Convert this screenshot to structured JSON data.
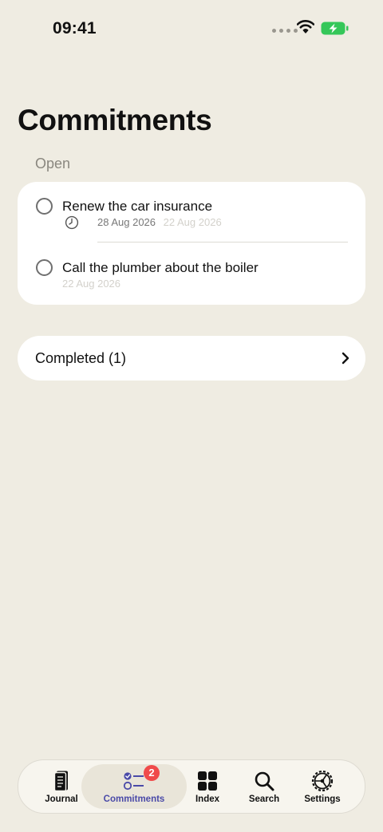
{
  "status_bar": {
    "time": "09:41",
    "battery_color": "#35c759"
  },
  "header": {
    "title": "Commitments"
  },
  "open_section": {
    "label": "Open",
    "tasks": [
      {
        "title": "Renew the car insurance",
        "due_date": "28 Aug 2026",
        "created_date": "22 Aug 2026",
        "icon": "clock-icon"
      },
      {
        "title": "Call the plumber about the boiler",
        "created_date": "22 Aug 2026"
      }
    ]
  },
  "completed": {
    "label": "Completed (1)"
  },
  "tab_bar": {
    "tabs": [
      {
        "label": "Journal",
        "icon": "journal-icon"
      },
      {
        "label": "Commitments",
        "icon": "commitments-icon",
        "active": true,
        "badge": "2"
      },
      {
        "label": "Index",
        "icon": "grid-icon"
      },
      {
        "label": "Search",
        "icon": "search-icon"
      },
      {
        "label": "Settings",
        "icon": "gear-icon"
      }
    ],
    "accent_color": "#4a4aa8",
    "badge_color": "#f04a4a"
  }
}
